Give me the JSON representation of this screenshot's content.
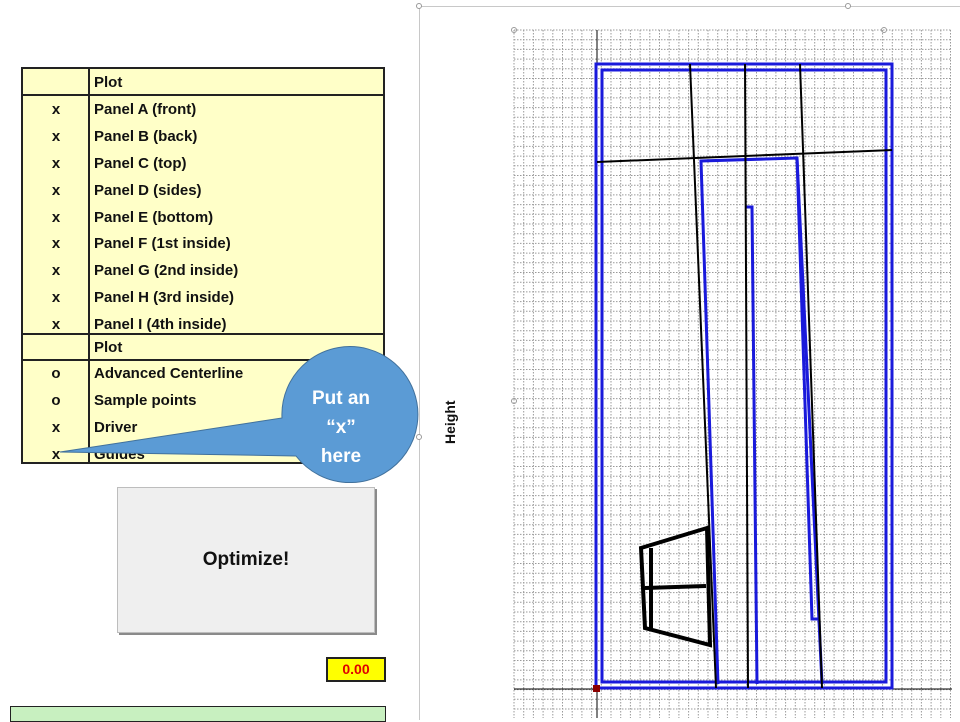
{
  "panel_table": {
    "header": "Plot",
    "rows": [
      {
        "mark": "x",
        "label": "Panel A (front)"
      },
      {
        "mark": "x",
        "label": "Panel B (back)"
      },
      {
        "mark": "x",
        "label": "Panel C (top)"
      },
      {
        "mark": "x",
        "label": "Panel D (sides)"
      },
      {
        "mark": "x",
        "label": "Panel E (bottom)"
      },
      {
        "mark": "x",
        "label": "Panel F (1st inside)"
      },
      {
        "mark": "x",
        "label": "Panel G (2nd inside)"
      },
      {
        "mark": "x",
        "label": "Panel H (3rd inside)"
      },
      {
        "mark": "x",
        "label": "Panel I (4th inside)"
      }
    ]
  },
  "extras_table": {
    "header": "Plot",
    "rows": [
      {
        "mark": "o",
        "label": "Advanced Centerline"
      },
      {
        "mark": "o",
        "label": "Sample points"
      },
      {
        "mark": "x",
        "label": "Driver"
      },
      {
        "mark": "x",
        "label": "Guides"
      }
    ]
  },
  "callout": {
    "line1": "Put an",
    "line2": "“x”",
    "line3": "here",
    "color": "#5b9bd5"
  },
  "optimize_button": {
    "label": "Optimize!"
  },
  "result_value": "0.00",
  "chart": {
    "ylabel": "Height",
    "blue": "#1a1adb",
    "black": "#000000",
    "grid_color": "#9a9a9a"
  }
}
